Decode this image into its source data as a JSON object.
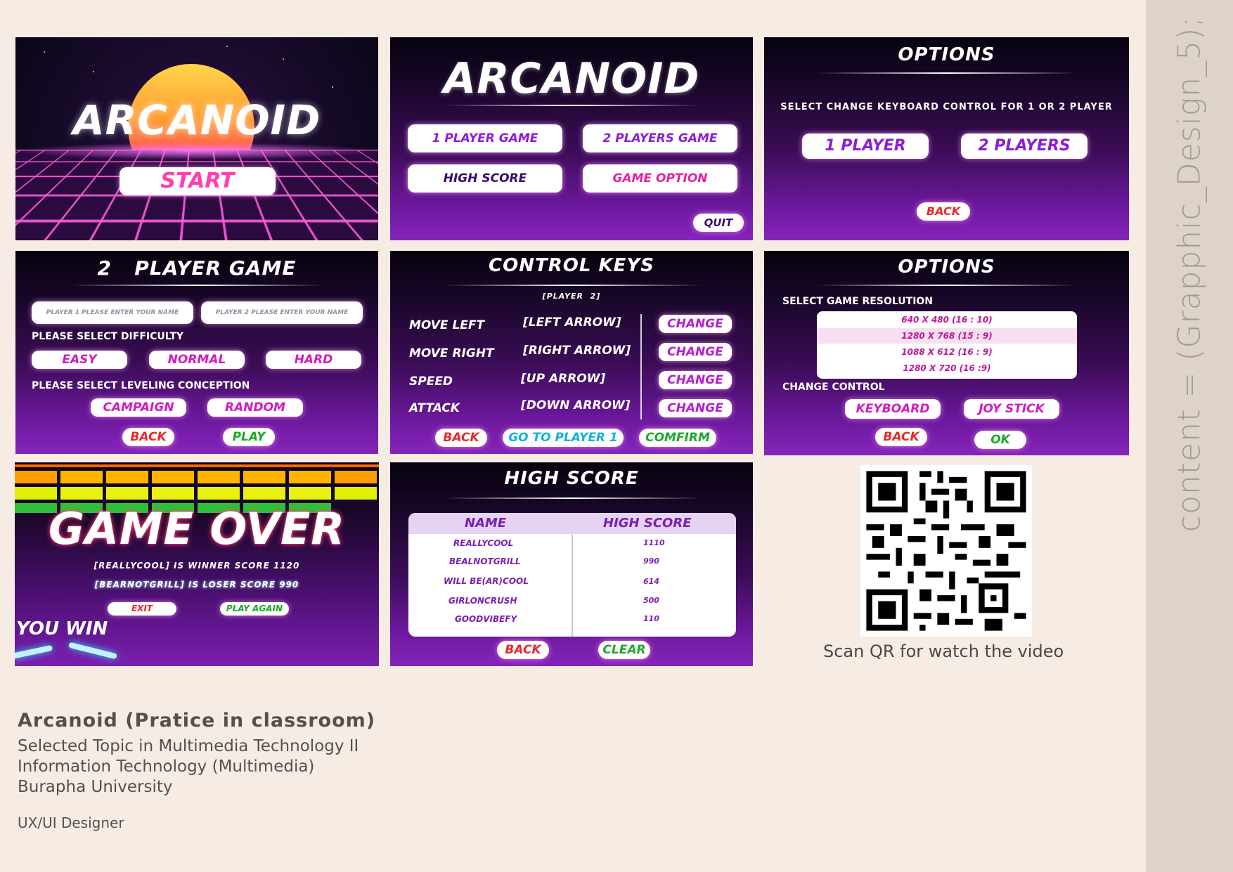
{
  "side_label": "content = (Grapphic_Design_5);",
  "title_screen": {
    "title": "ARCANOID",
    "start_label": "START"
  },
  "main_menu": {
    "title": "ARCANOID",
    "one_player": "1 PLAYER GAME",
    "two_players": "2 PLAYERS GAME",
    "high_score": "HIGH SCORE",
    "game_option": "GAME OPTION",
    "quit": "QUIT"
  },
  "options_keyboard": {
    "title": "OPTIONS",
    "subtitle": "SELECT CHANGE KEYBOARD CONTROL FOR 1 OR 2 PLAYER",
    "one_player": "1 PLAYER",
    "two_players": "2 PLAYERS",
    "back": "BACK"
  },
  "two_player_game": {
    "title": "2   PLAYER GAME",
    "player1_placeholder": "PLAYER 1 PLEASE ENTER YOUR NAME",
    "player2_placeholder": "PLAYER 2 PLEASE ENTER YOUR NAME",
    "difficulty_label": "PLEASE SELECT DIFFICULTY",
    "easy": "EASY",
    "normal": "NORMAL",
    "hard": "HARD",
    "leveling_label": "PLEASE SELECT LEVELING CONCEPTION",
    "campaign": "CAMPAIGN",
    "random": "RANDOM",
    "back": "BACK",
    "play": "PLAY"
  },
  "control_keys": {
    "title": "CONTROL KEYS",
    "player": "[PLAYER  2]",
    "rows": [
      {
        "action": "MOVE LEFT",
        "key": "[LEFT ARROW]",
        "change": "CHANGE"
      },
      {
        "action": "MOVE RIGHT",
        "key": "[RIGHT ARROW]",
        "change": "CHANGE"
      },
      {
        "action": "SPEED",
        "key": "[UP ARROW]",
        "change": "CHANGE"
      },
      {
        "action": "ATTACK",
        "key": "[DOWN ARROW]",
        "change": "CHANGE"
      }
    ],
    "back": "BACK",
    "go_to_player1": "GO TO PLAYER 1",
    "confirm": "COMFIRM"
  },
  "options_resolution": {
    "title": "OPTIONS",
    "resolution_label": "SELECT GAME RESOLUTION",
    "resolutions": [
      "640 X 480 (16 : 10)",
      "1280 X 768 (15 : 9)",
      "1088 X 612 (16 : 9)",
      "1280 X 720 (16 :9)"
    ],
    "change_control_label": "CHANGE CONTROL",
    "keyboard": "KEYBOARD",
    "joystick": "JOY STICK",
    "back": "BACK",
    "ok": "OK"
  },
  "game_over": {
    "title": "GAME OVER",
    "winner_line": "[REALLYCOOL] IS WINNER SCORE 1120",
    "loser_line": "[BEARNOTGRILL] IS LOSER SCORE 990",
    "exit": "EXIT",
    "play_again": "PLAY AGAIN",
    "you_win": "YOU WIN"
  },
  "high_score": {
    "title": "HIGH SCORE",
    "col_name": "NAME",
    "col_score": "HIGH SCORE",
    "rows": [
      {
        "name": "REALLYCOOL",
        "score": "1110"
      },
      {
        "name": "BEALNOTGRILL",
        "score": "990"
      },
      {
        "name": "WILL BE(AR)COOL",
        "score": "614"
      },
      {
        "name": "GIRLONCRUSH",
        "score": "500"
      },
      {
        "name": "GOODVIBEFY",
        "score": "110"
      }
    ],
    "back": "BACK",
    "clear": "CLEAR"
  },
  "qr_caption": "Scan QR for watch the video",
  "project": {
    "title": "Arcanoid (Pratice in classroom)",
    "line1": "Selected Topic in Multimedia Technology II",
    "line2": "Information Technology (Multimedia)",
    "line3": "Burapha University",
    "role": "UX/UI Designer"
  },
  "colors": {
    "background": "#f6ece3",
    "side_strip": "#ddd3c9",
    "panel_purple": "#6a189a",
    "accent_pink": "#e7239c",
    "accent_red": "#e8282c",
    "accent_green": "#1ca82a",
    "accent_cyan": "#11b3d8"
  }
}
